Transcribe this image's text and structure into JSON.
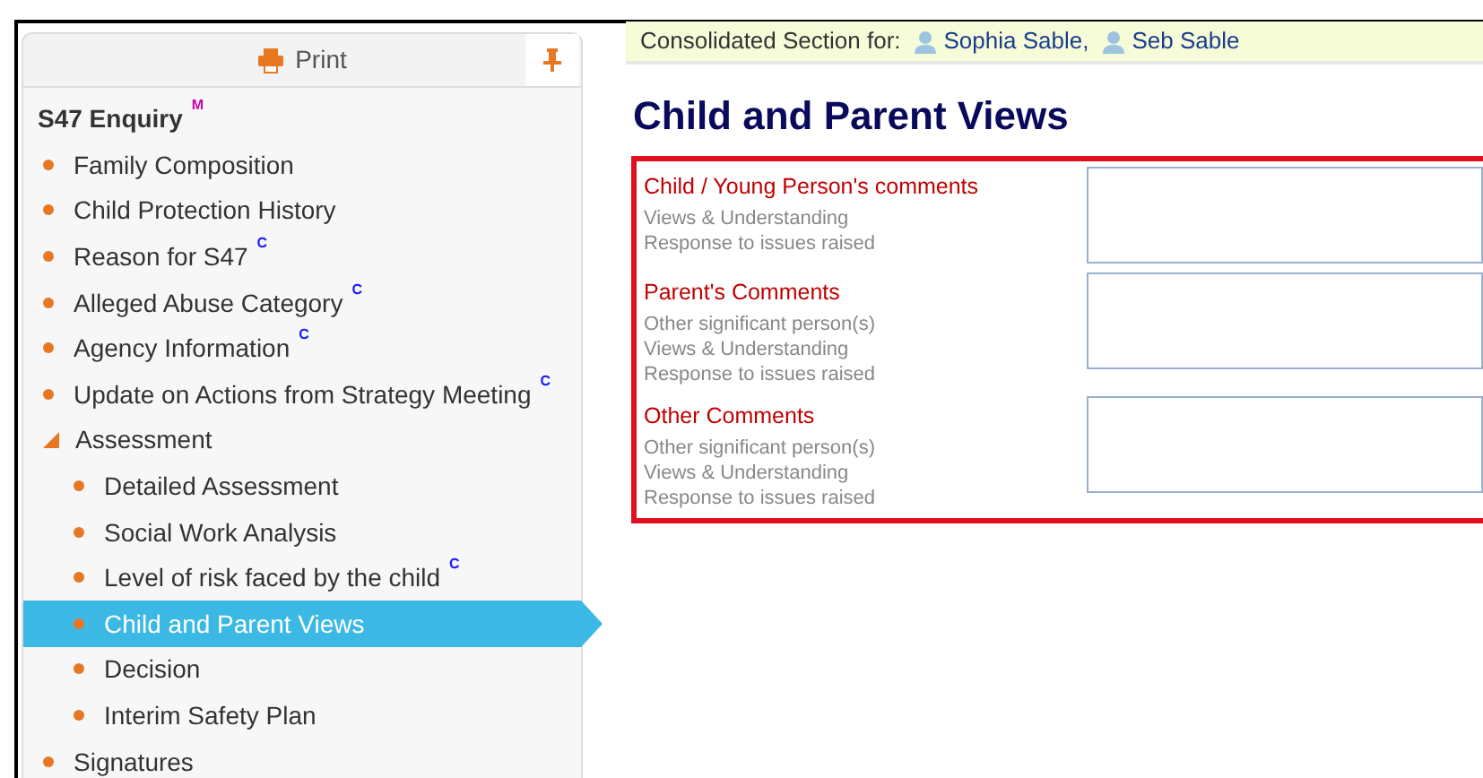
{
  "sidebar": {
    "print_label": "Print",
    "pinned": true,
    "title": "S47 Enquiry",
    "title_badge": {
      "text": "M",
      "color": "#cc00aa"
    },
    "items": [
      {
        "label": "Family Composition",
        "selected": false
      },
      {
        "label": "Child Protection History",
        "selected": false
      },
      {
        "label": "Reason for S47",
        "selected": false,
        "badge": {
          "text": "C",
          "color": "#1a1aff"
        }
      },
      {
        "label": "Alleged Abuse Category",
        "selected": false,
        "badge": {
          "text": "C",
          "color": "#1a1aff"
        }
      },
      {
        "label": "Agency Information",
        "selected": false,
        "badge": {
          "text": "C",
          "color": "#1a1aff"
        }
      },
      {
        "label": "Update on Actions from Strategy Meeting",
        "selected": false,
        "badge": {
          "text": "C",
          "color": "#1a1aff"
        }
      },
      {
        "label": "Assessment",
        "selected": false,
        "expanded": true,
        "children": [
          {
            "label": "Detailed Assessment",
            "selected": false
          },
          {
            "label": "Social Work Analysis",
            "selected": false
          },
          {
            "label": "Level of risk faced by the child",
            "selected": false,
            "badge": {
              "text": "C",
              "color": "#1a1aff"
            }
          },
          {
            "label": "Child and Parent Views",
            "selected": true
          },
          {
            "label": "Decision",
            "selected": false
          },
          {
            "label": "Interim Safety Plan",
            "selected": false
          }
        ]
      },
      {
        "label": "Signatures",
        "selected": false
      }
    ]
  },
  "consolidated": {
    "label": "Consolidated Section for:",
    "people": [
      "Sophia Sable,",
      "Seb Sable"
    ]
  },
  "heading": "Child and Parent Views",
  "sections": [
    {
      "title": "Child / Young Person's comments",
      "hints": [
        "Views & Understanding",
        "Response to issues raised"
      ]
    },
    {
      "title": "Parent's Comments",
      "hints": [
        "Other significant person(s)",
        "Views & Understanding",
        "Response to issues raised"
      ]
    },
    {
      "title": "Other Comments",
      "hints": [
        "Other significant person(s)",
        "Views & Understanding",
        "Response to issues raised"
      ]
    }
  ]
}
